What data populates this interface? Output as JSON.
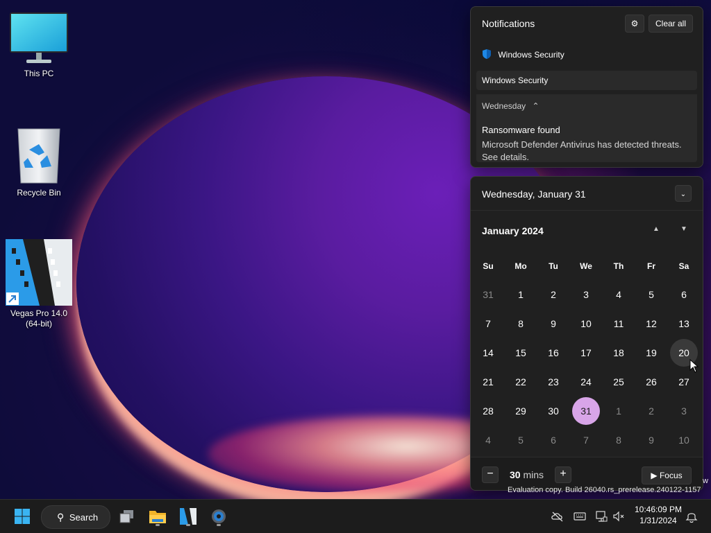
{
  "desktop": {
    "icons": [
      {
        "label": "This PC"
      },
      {
        "label": "Recycle Bin"
      },
      {
        "label": "Vegas Pro 14.0 (64-bit)"
      }
    ]
  },
  "notifications": {
    "title": "Notifications",
    "clear_all": "Clear all",
    "app_name": "Windows Security",
    "group_title": "Windows Security",
    "day": "Wednesday",
    "item_title": "Ransomware found",
    "item_body": "Microsoft Defender Antivirus has detected threats. See details."
  },
  "calendar": {
    "date_header": "Wednesday, January 31",
    "month_label": "January 2024",
    "weekdays": [
      "Su",
      "Mo",
      "Tu",
      "We",
      "Th",
      "Fr",
      "Sa"
    ],
    "weeks": [
      [
        "31",
        "1",
        "2",
        "3",
        "4",
        "5",
        "6"
      ],
      [
        "7",
        "8",
        "9",
        "10",
        "11",
        "12",
        "13"
      ],
      [
        "14",
        "15",
        "16",
        "17",
        "18",
        "19",
        "20"
      ],
      [
        "21",
        "22",
        "23",
        "24",
        "25",
        "26",
        "27"
      ],
      [
        "28",
        "29",
        "30",
        "31",
        "1",
        "2",
        "3"
      ],
      [
        "4",
        "5",
        "6",
        "7",
        "8",
        "9",
        "10"
      ]
    ],
    "today": "31",
    "accent_color": "#d8a5e8"
  },
  "focus": {
    "minutes": "30",
    "unit": "mins",
    "button": "Focus"
  },
  "taskbar": {
    "search_label": "Search",
    "time": "10:46:09 PM",
    "date": "1/31/2024"
  },
  "watermark": {
    "line": "Evaluation copy. Build 26040.rs_prerelease.240122-1157",
    "partial": "w"
  }
}
